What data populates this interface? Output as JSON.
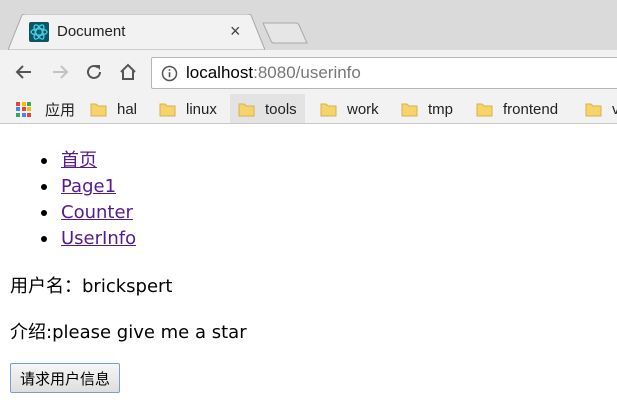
{
  "browser": {
    "tab_title": "Document",
    "tab_close": "×",
    "url_host": "localhost",
    "url_rest": ":8080/userinfo"
  },
  "bookmarks": {
    "apps_label": "应用",
    "folders": [
      "hal",
      "linux",
      "tools",
      "work",
      "tmp",
      "frontend",
      "v"
    ]
  },
  "page": {
    "nav_links": [
      "首页",
      "Page1",
      "Counter",
      "UserInfo"
    ],
    "username_line": "用户名：brickspert",
    "intro_line": "介绍:please give me a star",
    "request_button": "请求用户信息"
  },
  "colors": {
    "link_visited": "#551a8b",
    "folder": "#f7d36b",
    "favicon": "#0b7a8a"
  }
}
